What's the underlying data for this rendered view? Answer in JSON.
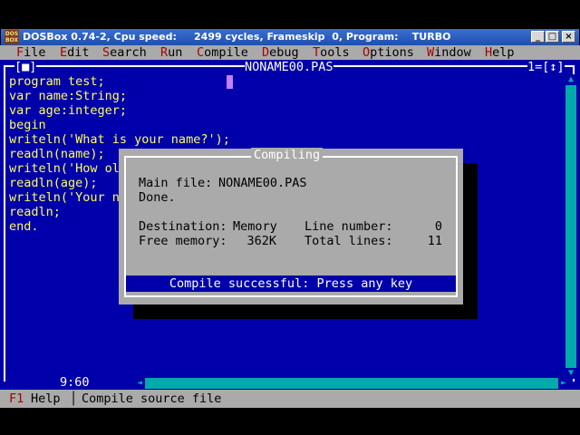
{
  "window": {
    "app_icon_label": "DOS BOX",
    "title": "DOSBox 0.74-2, Cpu speed:     2499 cycles, Frameskip  0, Program:    TURBO",
    "minimize_glyph": "_",
    "maximize_glyph": "□",
    "close_glyph": "×"
  },
  "menu": {
    "items": [
      {
        "hotkey": "F",
        "rest": "ile"
      },
      {
        "hotkey": "E",
        "rest": "dit"
      },
      {
        "hotkey": "S",
        "rest": "earch"
      },
      {
        "hotkey": "R",
        "rest": "un"
      },
      {
        "hotkey": "C",
        "rest": "ompile"
      },
      {
        "hotkey": "D",
        "rest": "ebug"
      },
      {
        "hotkey": "T",
        "rest": "ools"
      },
      {
        "hotkey": "O",
        "rest": "ptions"
      },
      {
        "hotkey": "W",
        "rest": "indow"
      },
      {
        "hotkey": "H",
        "rest": "elp"
      }
    ]
  },
  "editor": {
    "close_box": "[■]",
    "file_name": "NONAME00.PAS",
    "window_number": "1=[↕]",
    "code_lines": [
      "program test;",
      "var name:String;",
      "var age:integer;",
      "begin",
      "writeln('What is your name?');",
      "readln(name);",
      "writeln('How ol",
      "readln(age);",
      "writeln('Your n",
      "readln;",
      "end."
    ],
    "cursor_position": "9:60",
    "scroll_up_glyph": "▲",
    "scroll_down_glyph": "▼",
    "scroll_left_glyph": "◄",
    "scroll_right_glyph": "►"
  },
  "dialog": {
    "title": "Compiling",
    "main_file_label": "Main file:",
    "main_file_value": "NONAME00.PAS",
    "done_text": "Done.",
    "destination_label": "Destination:",
    "destination_value": "Memory",
    "line_number_label": "Line number:",
    "line_number_value": "0",
    "free_memory_label": "Free memory:",
    "free_memory_value": "362K",
    "total_lines_label": "Total lines:",
    "total_lines_value": "11",
    "status": "Compile successful: Press any key"
  },
  "statusbar": {
    "f1_key": "F1",
    "f1_label": "Help",
    "hint": "Compile source file"
  }
}
